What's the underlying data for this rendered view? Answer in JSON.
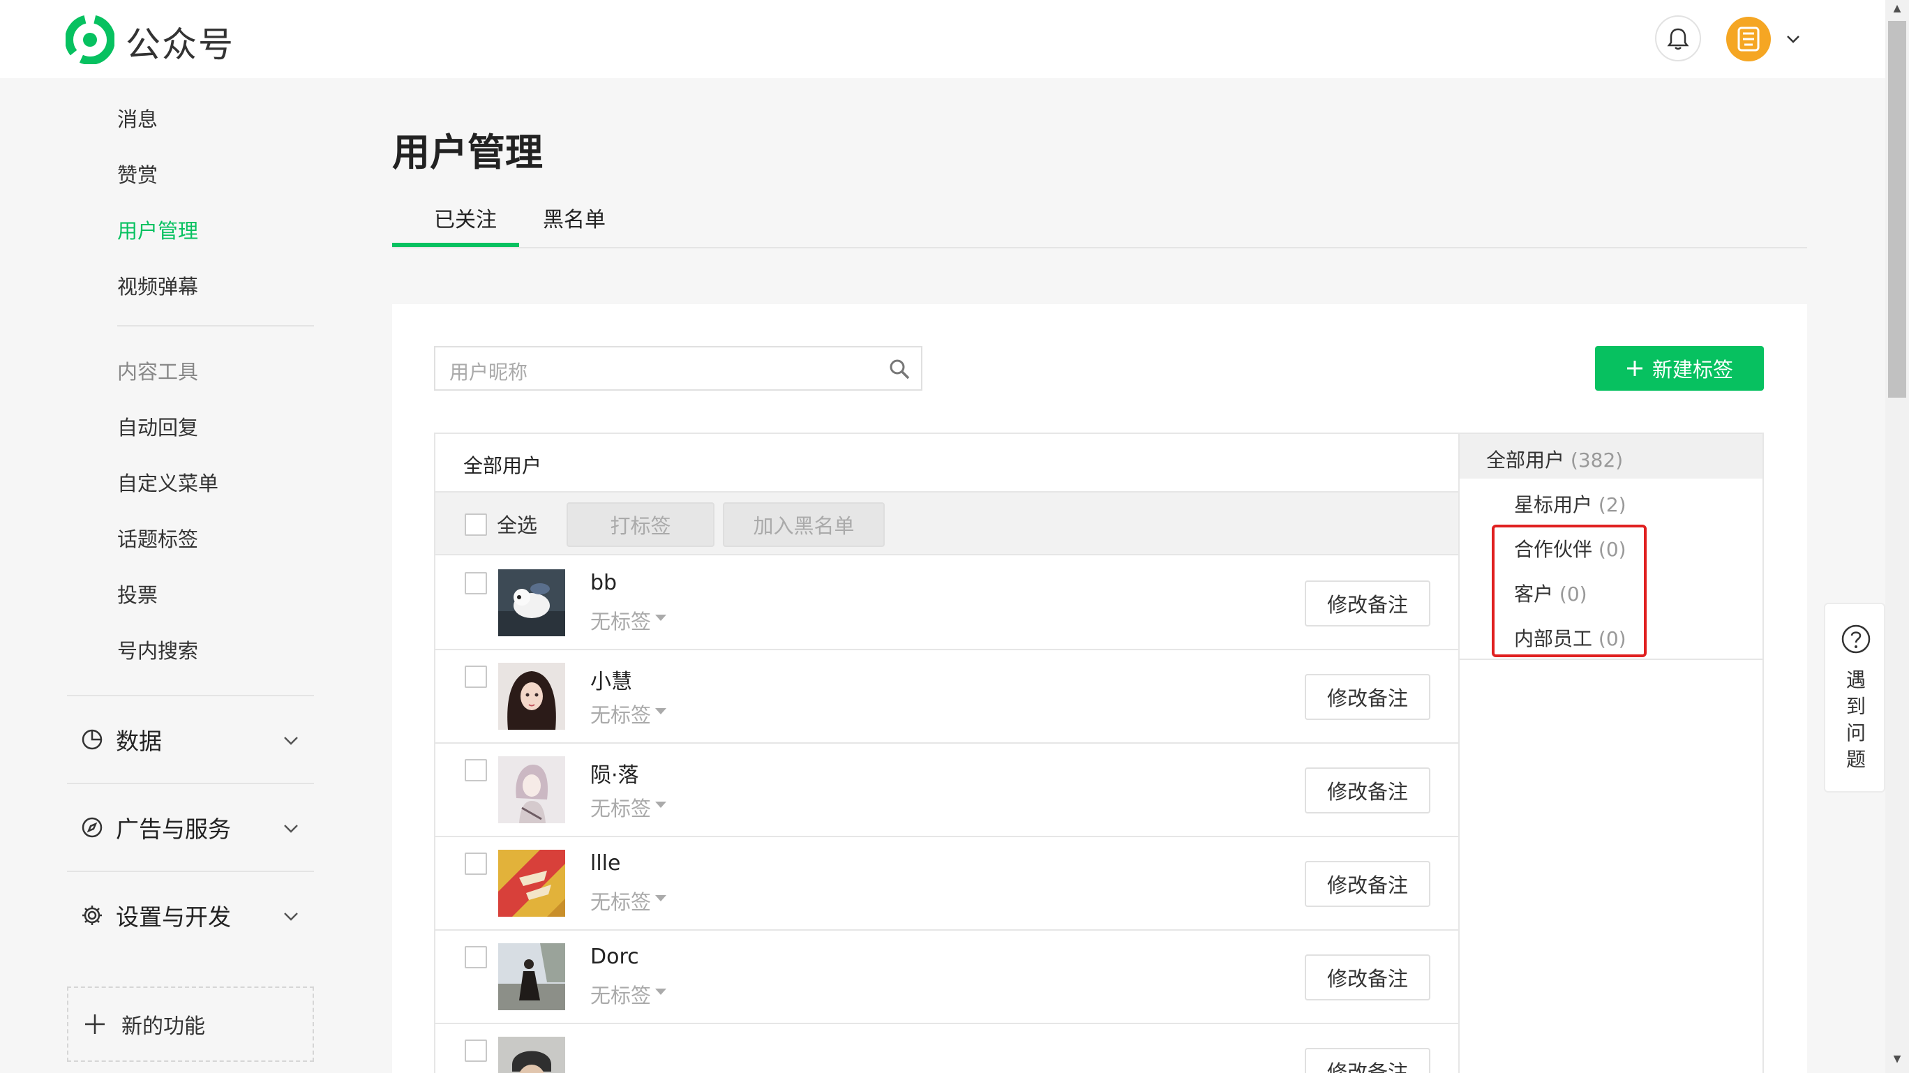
{
  "header": {
    "brand": "公众号",
    "bell_icon": "bell-icon",
    "avatar_glyph": "㗊",
    "accent": "#07c160"
  },
  "sidebar": {
    "top_items": [
      {
        "label": "消息"
      },
      {
        "label": "赞赏"
      },
      {
        "label": "用户管理",
        "active": true
      },
      {
        "label": "视频弹幕"
      }
    ],
    "tools_title": "内容工具",
    "tool_items": [
      {
        "label": "自动回复"
      },
      {
        "label": "自定义菜单"
      },
      {
        "label": "话题标签"
      },
      {
        "label": "投票"
      },
      {
        "label": "号内搜索"
      }
    ],
    "sections": [
      {
        "label": "数据",
        "icon": "pie-chart-icon"
      },
      {
        "label": "广告与服务",
        "icon": "compass-icon"
      },
      {
        "label": "设置与开发",
        "icon": "gear-icon"
      }
    ],
    "new_feature": "新的功能"
  },
  "main": {
    "title": "用户管理",
    "tabs": [
      {
        "label": "已关注",
        "active": true
      },
      {
        "label": "黑名单"
      }
    ],
    "search": {
      "placeholder": "用户昵称"
    },
    "new_tag_button": "新建标签",
    "list": {
      "header": "全部用户",
      "select_all": "全选",
      "tag_button": "打标签",
      "blacklist_button": "加入黑名单",
      "rows": [
        {
          "name": "bb",
          "tag": "无标签",
          "remark": "修改备注"
        },
        {
          "name": "小慧",
          "tag": "无标签",
          "remark": "修改备注"
        },
        {
          "name": "陨·落",
          "tag": "无标签",
          "remark": "修改备注"
        },
        {
          "name": "llle",
          "tag": "无标签",
          "remark": "修改备注"
        },
        {
          "name": "Dorc",
          "tag": "无标签",
          "remark": "修改备注"
        },
        {
          "name": "",
          "tag": "",
          "remark": "修改备注"
        }
      ]
    },
    "tag_panel": {
      "all": {
        "label": "全部用户",
        "count": "(382)"
      },
      "items": [
        {
          "label": "星标用户",
          "count": "(2)"
        },
        {
          "label": "合作伙伴",
          "count": "(0)"
        },
        {
          "label": "客户",
          "count": "(0)"
        },
        {
          "label": "内部员工",
          "count": "(0)"
        }
      ],
      "highlight_color": "#e02020"
    }
  },
  "help": {
    "text": "遇到问题"
  }
}
